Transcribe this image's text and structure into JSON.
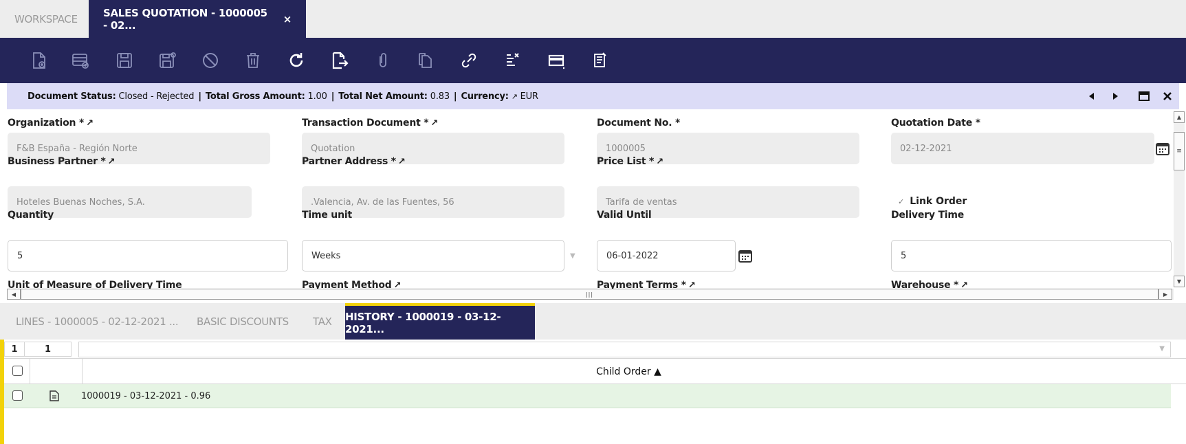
{
  "tabs": {
    "workspace": "WORKSPACE",
    "sales_quotation": "SALES QUOTATION - 1000005 - 02...",
    "close": "×"
  },
  "toolbar": {
    "icons": [
      "new-document-icon",
      "new-row-icon",
      "save-icon",
      "save-close-icon",
      "cancel-icon",
      "delete-icon",
      "refresh-icon",
      "export-icon",
      "attachment-icon",
      "clone-icon",
      "link-icon",
      "report-icon",
      "view-form-icon",
      "notes-icon"
    ]
  },
  "status": {
    "doc_status_label": "Document Status:",
    "doc_status_value": "Closed - Rejected",
    "sep": "|",
    "gross_label": "Total Gross Amount:",
    "gross_value": "1.00",
    "net_label": "Total Net Amount:",
    "net_value": "0.83",
    "currency_label": "Currency:",
    "currency_value": "EUR",
    "pin": "↗"
  },
  "form": {
    "organization": {
      "label": "Organization *",
      "value": "F&B España - Región Norte"
    },
    "transaction_document": {
      "label": "Transaction Document *",
      "value": "Quotation"
    },
    "document_no": {
      "label": "Document No. *",
      "value": "1000005"
    },
    "quotation_date": {
      "label": "Quotation Date *",
      "value": "02-12-2021"
    },
    "business_partner": {
      "label": "Business Partner *",
      "value": "Hoteles Buenas Noches, S.A."
    },
    "partner_address": {
      "label": "Partner Address *",
      "value": ".Valencia, Av. de las Fuentes, 56"
    },
    "price_list": {
      "label": "Price List *",
      "value": "Tarifa de ventas"
    },
    "link_order": {
      "label": "Link Order",
      "checked": true
    },
    "quantity": {
      "label": "Quantity",
      "value": "5"
    },
    "time_unit": {
      "label": "Time unit",
      "value": "Weeks"
    },
    "valid_until": {
      "label": "Valid Until",
      "value": "06-01-2022"
    },
    "delivery_time": {
      "label": "Delivery Time",
      "value": "5"
    },
    "uom_delivery_time": {
      "label": "Unit of Measure of Delivery Time"
    },
    "payment_method": {
      "label": "Payment Method"
    },
    "payment_terms": {
      "label": "Payment Terms *"
    },
    "warehouse": {
      "label": "Warehouse *"
    }
  },
  "subtabs": {
    "lines": "LINES - 1000005 - 02-12-2021 ...",
    "basic_discounts": "BASIC DISCOUNTS",
    "tax": "TAX",
    "history": "HISTORY - 1000019 - 03-12-2021..."
  },
  "grid": {
    "count_selected": "1",
    "count_total": "1",
    "column_header": "Child Order ▲",
    "rows": [
      {
        "value": "1000019 - 03-12-2021 - 0.96"
      }
    ]
  },
  "colors": {
    "navy": "#242559",
    "accent": "#f2d20a",
    "status_bg": "#dcdcf7",
    "row_bg": "#e6f4e4"
  }
}
